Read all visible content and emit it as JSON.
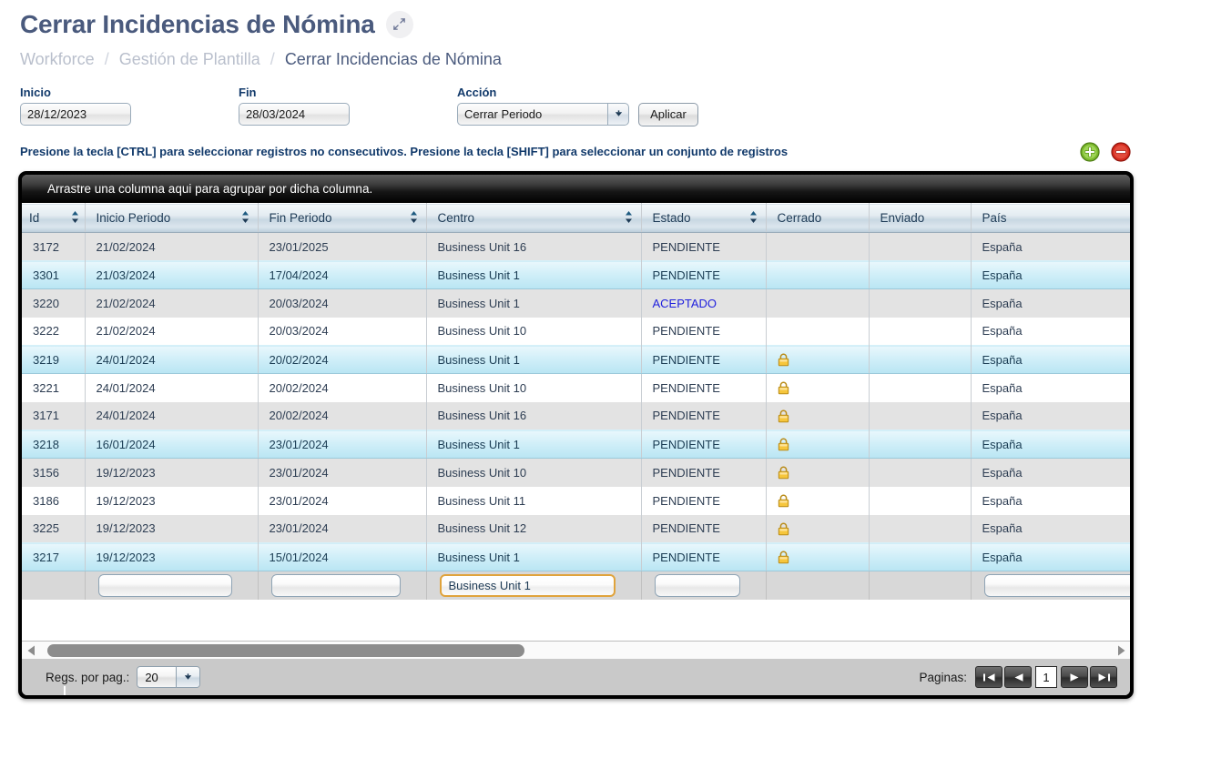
{
  "header": {
    "title": "Cerrar Incidencias de Nómina",
    "expand_icon": "expand-arrows-icon",
    "breadcrumb": [
      {
        "label": "Workforce",
        "current": false
      },
      {
        "label": "Gestión de Plantilla",
        "current": false
      },
      {
        "label": "Cerrar Incidencias de Nómina",
        "current": true
      }
    ],
    "separator": "/"
  },
  "filters": {
    "inicio": {
      "label": "Inicio",
      "value": "28/12/2023",
      "placeholder": ""
    },
    "fin": {
      "label": "Fin",
      "value": "28/03/2024",
      "placeholder": ""
    },
    "accion": {
      "label": "Acción",
      "value": "Cerrar Periodo",
      "arrow_icon": "chevron-down-icon"
    },
    "apply_button": "Aplicar"
  },
  "hint": {
    "text": "Presione la tecla [CTRL] para seleccionar registros no consecutivos. Presione la tecla [SHIFT] para seleccionar un conjunto de registros",
    "add_icon": "add-circle-icon",
    "remove_icon": "remove-circle-icon"
  },
  "grid": {
    "group_bar_text": "Arrastre una columna aqui para agrupar por dicha columna.",
    "columns": [
      {
        "key": "id",
        "label": "Id",
        "sortable": true
      },
      {
        "key": "inicio_periodo",
        "label": "Inicio Periodo",
        "sortable": true
      },
      {
        "key": "fin_periodo",
        "label": "Fin Periodo",
        "sortable": true
      },
      {
        "key": "centro",
        "label": "Centro",
        "sortable": true
      },
      {
        "key": "estado",
        "label": "Estado",
        "sortable": true
      },
      {
        "key": "cerrado",
        "label": "Cerrado",
        "sortable": false
      },
      {
        "key": "enviado",
        "label": "Enviado",
        "sortable": false
      },
      {
        "key": "pais",
        "label": "País",
        "sortable": true
      }
    ],
    "rows": [
      {
        "id": "3172",
        "inicio_periodo": "21/02/2024",
        "fin_periodo": "23/01/2025",
        "centro": "Business Unit 16",
        "estado": "PENDIENTE",
        "cerrado": "",
        "enviado": "",
        "pais": "España",
        "style": "gray"
      },
      {
        "id": "3301",
        "inicio_periodo": "21/03/2024",
        "fin_periodo": "17/04/2024",
        "centro": "Business Unit 1",
        "estado": "PENDIENTE",
        "cerrado": "",
        "enviado": "",
        "pais": "España",
        "style": "selected"
      },
      {
        "id": "3220",
        "inicio_periodo": "21/02/2024",
        "fin_periodo": "20/03/2024",
        "centro": "Business Unit 1",
        "estado": "ACEPTADO",
        "cerrado": "",
        "enviado": "",
        "pais": "España",
        "style": "gray"
      },
      {
        "id": "3222",
        "inicio_periodo": "21/02/2024",
        "fin_periodo": "20/03/2024",
        "centro": "Business Unit 10",
        "estado": "PENDIENTE",
        "cerrado": "",
        "enviado": "",
        "pais": "España",
        "style": "white"
      },
      {
        "id": "3219",
        "inicio_periodo": "24/01/2024",
        "fin_periodo": "20/02/2024",
        "centro": "Business Unit 1",
        "estado": "PENDIENTE",
        "cerrado": "lock-icon",
        "enviado": "",
        "pais": "España",
        "style": "selected"
      },
      {
        "id": "3221",
        "inicio_periodo": "24/01/2024",
        "fin_periodo": "20/02/2024",
        "centro": "Business Unit 10",
        "estado": "PENDIENTE",
        "cerrado": "lock-icon",
        "enviado": "",
        "pais": "España",
        "style": "white"
      },
      {
        "id": "3171",
        "inicio_periodo": "24/01/2024",
        "fin_periodo": "20/02/2024",
        "centro": "Business Unit 16",
        "estado": "PENDIENTE",
        "cerrado": "lock-icon",
        "enviado": "",
        "pais": "España",
        "style": "gray"
      },
      {
        "id": "3218",
        "inicio_periodo": "16/01/2024",
        "fin_periodo": "23/01/2024",
        "centro": "Business Unit 1",
        "estado": "PENDIENTE",
        "cerrado": "lock-icon",
        "enviado": "",
        "pais": "España",
        "style": "selected"
      },
      {
        "id": "3156",
        "inicio_periodo": "19/12/2023",
        "fin_periodo": "23/01/2024",
        "centro": "Business Unit 10",
        "estado": "PENDIENTE",
        "cerrado": "lock-icon",
        "enviado": "",
        "pais": "España",
        "style": "gray"
      },
      {
        "id": "3186",
        "inicio_periodo": "19/12/2023",
        "fin_periodo": "23/01/2024",
        "centro": "Business Unit 11",
        "estado": "PENDIENTE",
        "cerrado": "lock-icon",
        "enviado": "",
        "pais": "España",
        "style": "white"
      },
      {
        "id": "3225",
        "inicio_periodo": "19/12/2023",
        "fin_periodo": "23/01/2024",
        "centro": "Business Unit 12",
        "estado": "PENDIENTE",
        "cerrado": "lock-icon",
        "enviado": "",
        "pais": "España",
        "style": "gray"
      },
      {
        "id": "3217",
        "inicio_periodo": "19/12/2023",
        "fin_periodo": "15/01/2024",
        "centro": "Business Unit 1",
        "estado": "PENDIENTE",
        "cerrado": "lock-icon",
        "enviado": "",
        "pais": "España",
        "style": "selected"
      }
    ],
    "filter_row": {
      "id": {
        "value": "",
        "visible": false
      },
      "inicio_periodo": {
        "value": "",
        "visible": true,
        "focused": false
      },
      "fin_periodo": {
        "value": "",
        "visible": true,
        "focused": false
      },
      "centro": {
        "value": "Business Unit 1",
        "visible": true,
        "focused": true
      },
      "estado": {
        "value": "",
        "visible": true,
        "focused": false
      },
      "cerrado": {
        "value": "",
        "visible": false
      },
      "enviado": {
        "value": "",
        "visible": false
      },
      "pais": {
        "value": "",
        "visible": true,
        "focused": false
      }
    },
    "scrollbar": {
      "left_arrow_icon": "triangle-left-icon",
      "right_arrow_icon": "triangle-right-icon"
    }
  },
  "footer": {
    "regs_label": "Regs. por pag.:",
    "regs_value": "20",
    "regs_arrow_icon": "chevron-down-icon",
    "pages_label": "Paginas:",
    "current_page": "1",
    "first_icon": "page-first-icon",
    "prev_icon": "page-prev-icon",
    "next_icon": "page-next-icon",
    "last_icon": "page-last-icon"
  },
  "colors": {
    "title": "#4a5a7d",
    "breadcrumb_muted": "#b9bfcc",
    "label_blue": "#123a6b",
    "estado_aceptado": "#2020dd",
    "row_selected": "#cfeef8",
    "row_alt": "#e3e3e3",
    "add_icon": "#6ab024",
    "remove_icon": "#d42a20",
    "lock": "#f2b632",
    "focus_border": "#e0a33c"
  }
}
